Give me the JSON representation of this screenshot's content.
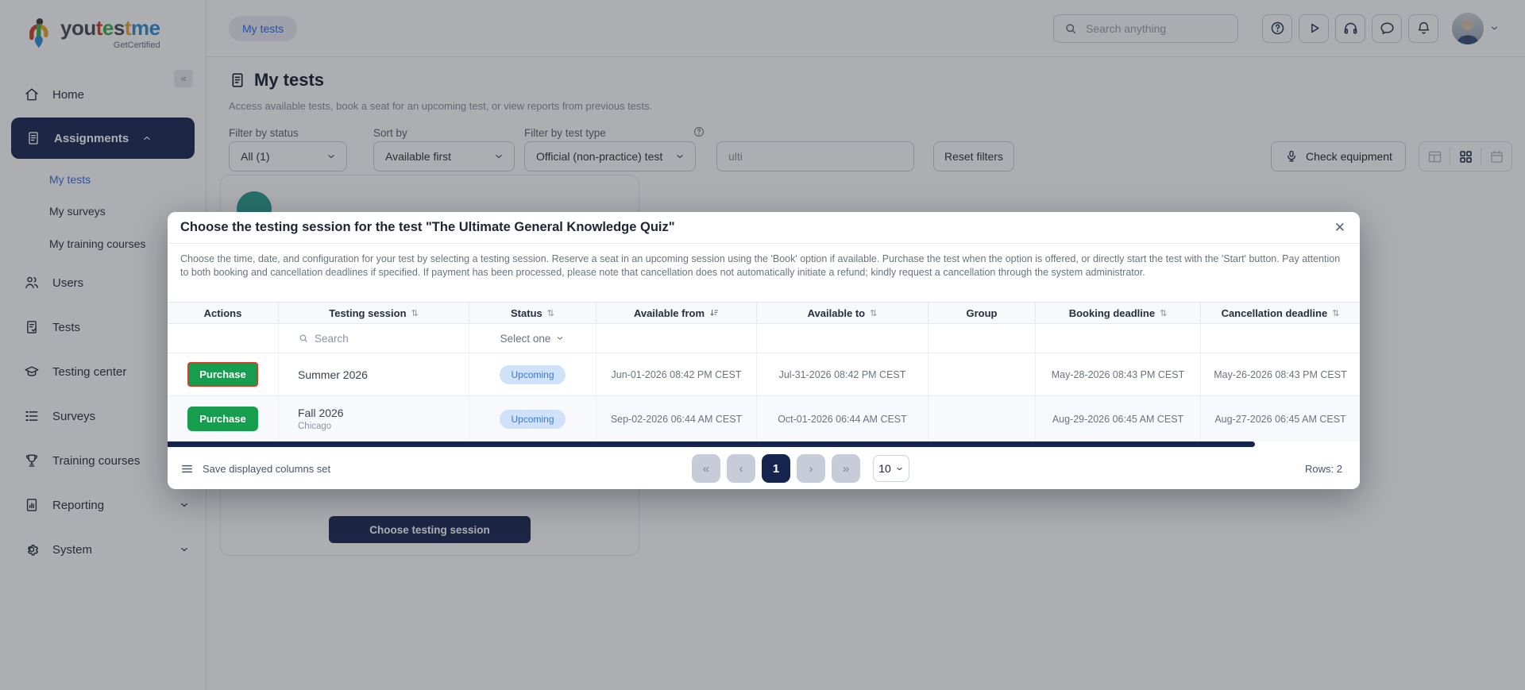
{
  "brand": {
    "segments": {
      "you": "you",
      "t1": "t",
      "e": "e",
      "s": "s",
      "t2": "t",
      "me": "me"
    },
    "tagline": "GetCertified",
    "colors": {
      "dark": "#4a4f55",
      "red": "#d2402f",
      "green": "#3fae49",
      "orange": "#eda428",
      "blue": "#2f8fd4"
    }
  },
  "sidebar": {
    "collapse_glyph": "«",
    "home": "Home",
    "assignments": "Assignments",
    "my_tests": "My tests",
    "my_surveys": "My surveys",
    "my_training_courses": "My training courses",
    "users": "Users",
    "tests": "Tests",
    "testing_center": "Testing center",
    "surveys": "Surveys",
    "training_courses": "Training courses",
    "reporting": "Reporting",
    "system": "System"
  },
  "topbar": {
    "breadcrumb": "My tests",
    "search_placeholder": "Search anything"
  },
  "page": {
    "title": "My tests",
    "subtitle": "Access available tests, book a seat for an upcoming test, or view reports from previous tests."
  },
  "filters": {
    "status_label": "Filter by status",
    "status_value": "All (1)",
    "sort_label": "Sort by",
    "sort_value": "Available first",
    "type_label": "Filter by test type",
    "type_value": "Official (non-practice) test",
    "search_value": "ulti",
    "reset_label": "Reset filters"
  },
  "toolbar": {
    "check_equipment": "Check equipment"
  },
  "test_card": {
    "choose_button": "Choose testing session"
  },
  "modal": {
    "title": "Choose the testing session for the test \"The Ultimate General Knowledge Quiz\"",
    "close_glyph": "✕",
    "description": "Choose the time, date, and configuration for your test by selecting a testing session. Reserve a seat in an upcoming session using the 'Book' option if available. Purchase the test when the option is offered, or directly start the test with the 'Start' button. Pay attention to both booking and cancellation deadlines if specified. If payment has been processed, please note that cancellation does not automatically initiate a refund; kindly request a cancellation through the system administrator.",
    "table": {
      "columns": [
        "Actions",
        "Testing session",
        "Status",
        "Available from",
        "Available to",
        "Group",
        "Booking deadline",
        "Cancellation deadline"
      ],
      "search_placeholder": "Search",
      "status_filter_placeholder": "Select one",
      "rows": [
        {
          "action": "Purchase",
          "session": "Summer 2026",
          "location": "",
          "status": "Upcoming",
          "available_from": "Jun-01-2026 08:42 PM CEST",
          "available_to": "Jul-31-2026 08:42 PM CEST",
          "group": "",
          "booking_deadline": "May-28-2026 08:43 PM CEST",
          "cancellation_deadline": "May-26-2026 08:43 PM CEST"
        },
        {
          "action": "Purchase",
          "session": "Fall 2026",
          "location": "Chicago",
          "status": "Upcoming",
          "available_from": "Sep-02-2026 06:44 AM CEST",
          "available_to": "Oct-01-2026 06:44 AM CEST",
          "group": "",
          "booking_deadline": "Aug-29-2026 06:45 AM CEST",
          "cancellation_deadline": "Aug-27-2026 06:45 AM CEST"
        }
      ]
    },
    "footer": {
      "save_columns": "Save displayed columns set",
      "first_glyph": "«",
      "prev_glyph": "‹",
      "page": "1",
      "next_glyph": "›",
      "last_glyph": "»",
      "page_size": "10",
      "rows_count": "Rows: 2"
    }
  },
  "icons": {
    "sort_both": "⇅"
  },
  "colors": {
    "navy": "#1b2a55",
    "green": "#169d4e",
    "focus_red": "#e0392c",
    "badge_bg": "#cfe2f9",
    "badge_text": "#3b77cf",
    "link_blue": "#2e6be6",
    "scrollbar": "#16254f"
  }
}
